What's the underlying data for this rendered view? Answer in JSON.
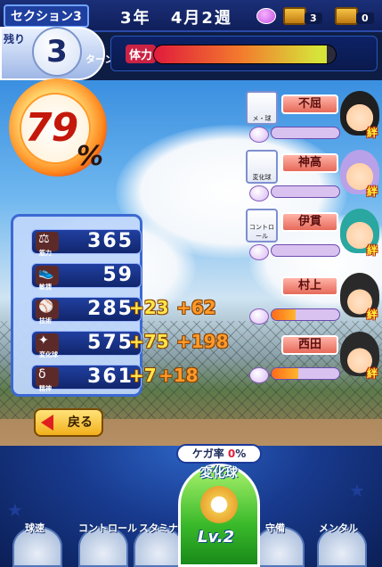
{
  "header": {
    "section_label": "セクション3",
    "year": "3年",
    "month_week": "4月2週",
    "chest1_count": "3",
    "chest2_count": "0"
  },
  "turns": {
    "remaining_label": "残り",
    "value": "3",
    "unit": "ターン"
  },
  "stamina": {
    "label": "体力",
    "level": 0.95
  },
  "success": {
    "value": "79",
    "unit": "%"
  },
  "stats": [
    {
      "name": "筋力",
      "value": "365",
      "bonus1": "",
      "bonus2": ""
    },
    {
      "name": "敏捷",
      "value": "59",
      "bonus1": "",
      "bonus2": ""
    },
    {
      "name": "技術",
      "value": "285",
      "bonus1": "+23",
      "bonus2": "+62"
    },
    {
      "name": "変化球",
      "value": "575",
      "bonus1": "+75",
      "bonus2": "+198"
    },
    {
      "name": "精神",
      "value": "361",
      "bonus1": "+7",
      "bonus2": "+18"
    }
  ],
  "back_button": {
    "label": "戻る"
  },
  "teammates": [
    {
      "name": "不屈",
      "card_tag": "メ・球",
      "bond_label": "絆",
      "bond_level": 0.0
    },
    {
      "name": "神高",
      "card_tag": "変化球",
      "bond_label": "絆",
      "bond_level": 0.0
    },
    {
      "name": "伊貫",
      "card_tag": "コントロール",
      "bond_label": "絆",
      "bond_level": 0.0
    },
    {
      "name": "村上",
      "card_tag": "",
      "bond_label": "絆",
      "bond_level": 0.35
    },
    {
      "name": "西田",
      "card_tag": "",
      "bond_label": "絆",
      "bond_level": 0.4
    }
  ],
  "injury": {
    "label": "ケガ率",
    "value": "0",
    "unit": "%"
  },
  "selected_training": {
    "label": "変化球",
    "level": "Lv.2"
  },
  "trainings": [
    {
      "label": "球速"
    },
    {
      "label": "コントロール"
    },
    {
      "label": "スタミナ"
    },
    {
      "label": "守備"
    },
    {
      "label": "メンタル"
    }
  ],
  "colors": {
    "accent": "#1b2f78",
    "success_red": "#c4180b",
    "bonus_yellow": "#ffe64a",
    "bonus_orange": "#ff9a2a",
    "train_green": "#39b92a"
  }
}
